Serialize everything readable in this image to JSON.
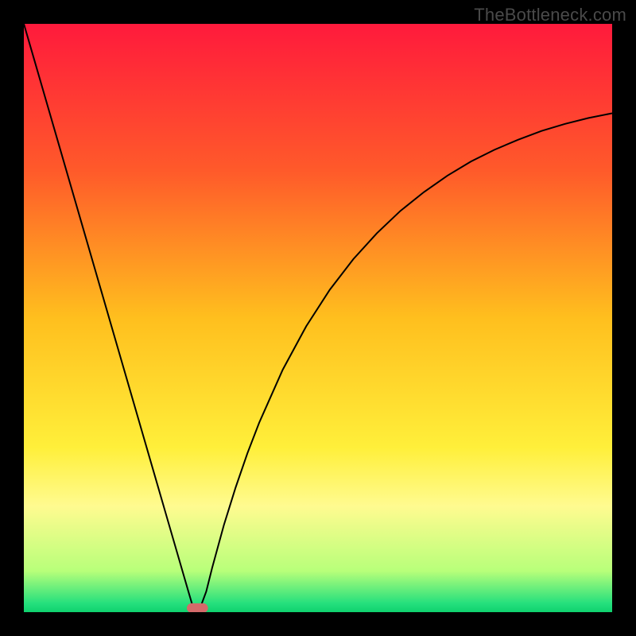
{
  "watermark": "TheBottleneck.com",
  "chart_data": {
    "type": "line",
    "title": "",
    "xlabel": "",
    "ylabel": "",
    "xlim": [
      0,
      100
    ],
    "ylim": [
      0,
      100
    ],
    "grid": false,
    "legend": false,
    "background": {
      "type": "vertical-gradient",
      "stops": [
        {
          "pos": 0.0,
          "color": "#ff1a3c"
        },
        {
          "pos": 0.25,
          "color": "#ff5a2a"
        },
        {
          "pos": 0.5,
          "color": "#ffbf1e"
        },
        {
          "pos": 0.72,
          "color": "#ffef3a"
        },
        {
          "pos": 0.82,
          "color": "#fffb90"
        },
        {
          "pos": 0.93,
          "color": "#b8ff7a"
        },
        {
          "pos": 0.985,
          "color": "#25e07d"
        },
        {
          "pos": 1.0,
          "color": "#0fd16e"
        }
      ]
    },
    "series": [
      {
        "name": "bottleneck-curve",
        "color": "#000000",
        "stroke_width": 2,
        "x": [
          0,
          2,
          4,
          6,
          8,
          10,
          12,
          14,
          16,
          18,
          20,
          22,
          24,
          26,
          28,
          29,
          30,
          31,
          32,
          34,
          36,
          38,
          40,
          44,
          48,
          52,
          56,
          60,
          64,
          68,
          72,
          76,
          80,
          84,
          88,
          92,
          96,
          100
        ],
        "y": [
          100,
          93.1,
          86.2,
          79.3,
          72.4,
          65.5,
          58.6,
          51.7,
          44.8,
          37.9,
          31.0,
          24.1,
          17.2,
          10.3,
          3.4,
          0.0,
          0.8,
          3.5,
          7.5,
          14.8,
          21.2,
          27.0,
          32.2,
          41.2,
          48.6,
          54.8,
          60.0,
          64.4,
          68.2,
          71.4,
          74.2,
          76.6,
          78.6,
          80.3,
          81.8,
          83.0,
          84.0,
          84.8
        ]
      }
    ],
    "marker": {
      "name": "bottleneck-min-marker",
      "shape": "rounded-rect",
      "color": "#d46a6a",
      "x_center": 29.5,
      "y_center": 0.7,
      "width": 3.6,
      "height": 1.6
    }
  }
}
